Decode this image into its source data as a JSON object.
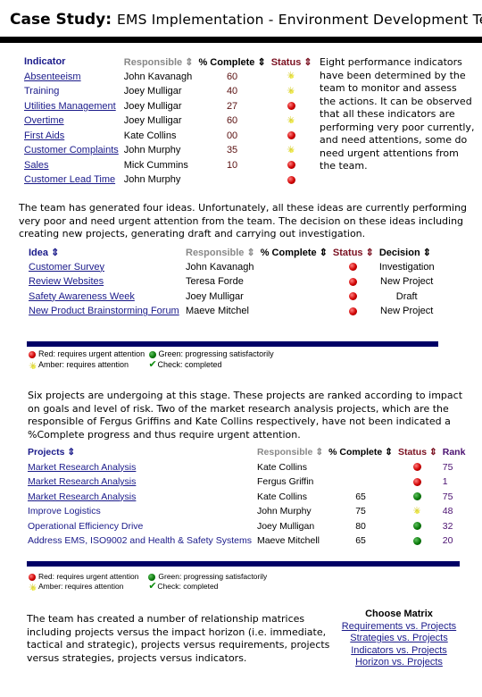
{
  "header": {
    "label": "Case Study:",
    "title": "EMS Implementation - Environment Development Team"
  },
  "indicators": {
    "columns": [
      "Indicator",
      "Responsible ⇕",
      "% Complete ⇕",
      "Status ⇕"
    ],
    "rows": [
      {
        "name": "Absenteeism",
        "link": true,
        "responsible": "John Kavanagh",
        "complete": "60",
        "status": "amber"
      },
      {
        "name": "Training",
        "link": false,
        "responsible": "Joey Mulligar",
        "complete": "40",
        "status": "amber"
      },
      {
        "name": "Utilities Management",
        "link": true,
        "responsible": "Joey Mulligar",
        "complete": "27",
        "status": "red"
      },
      {
        "name": "Overtime",
        "link": true,
        "responsible": "Joey Mulligar",
        "complete": "60",
        "status": "amber"
      },
      {
        "name": "First Aids",
        "link": true,
        "responsible": "Kate Collins",
        "complete": "00",
        "status": "red"
      },
      {
        "name": "Customer Complaints",
        "link": true,
        "responsible": "John Murphy",
        "complete": "35",
        "status": "amber"
      },
      {
        "name": "Sales",
        "link": true,
        "responsible": "Mick Cummins",
        "complete": "10",
        "status": "red"
      },
      {
        "name": "Customer Lead Time",
        "link": true,
        "responsible": "John Murphy",
        "complete": "",
        "status": "red"
      }
    ],
    "note": "Eight performance indicators have been determined by the team to monitor and assess the actions. It can be observed that all these indicators are performing very poor currently, and need attentions, some do need urgent attentions from the team."
  },
  "ideas": {
    "intro": "The team has generated four ideas. Unfortunately, all these ideas are currently performing very poor and need urgent attention from the team. The decision on these ideas including creating new projects, generating draft and carrying out investigation.",
    "columns": [
      "Idea ⇕",
      "Responsible ⇕",
      "% Complete ⇕",
      "Status ⇕",
      "Decision ⇕"
    ],
    "rows": [
      {
        "name": "Customer Survey",
        "responsible": "John Kavanagh",
        "complete": "",
        "status": "red",
        "decision": "Investigation"
      },
      {
        "name": "Review Websites",
        "responsible": "Teresa Forde",
        "complete": "",
        "status": "red",
        "decision": "New Project"
      },
      {
        "name": "Safety Awareness Week",
        "responsible": "Joey Mulligar",
        "complete": "",
        "status": "red",
        "decision": "Draft"
      },
      {
        "name": "New Product Brainstorming Forum",
        "responsible": "Maeve Mitchel",
        "complete": "",
        "status": "red",
        "decision": "New Project"
      }
    ]
  },
  "legend": {
    "red": "Red: requires urgent attention",
    "green": "Green: progressing satisfactorily",
    "amber": "Amber: requires attention",
    "check": "Check: completed"
  },
  "projects": {
    "intro": "Six projects are undergoing at this stage. These projects are ranked according to impact on goals and level of risk. Two of the market research analysis projects, which are the responsible of Fergus Griffins and Kate Collins respectively, have not been indicated a %Complete progress and thus require urgent attention.",
    "columns": [
      "Projects ⇕",
      "Responsible ⇕",
      "% Complete ⇕",
      "Status ⇕",
      "Rank"
    ],
    "rows": [
      {
        "name": "Market Research Analysis",
        "link": true,
        "responsible": "Kate Collins",
        "complete": "",
        "status": "red",
        "rank": "75"
      },
      {
        "name": "Market Research Analysis",
        "link": true,
        "responsible": "Fergus Griffin",
        "complete": "",
        "status": "red",
        "rank": "1"
      },
      {
        "name": "Market Research Analysis",
        "link": true,
        "responsible": "Kate Collins",
        "complete": "65",
        "status": "green",
        "rank": "75"
      },
      {
        "name": "Improve Logistics",
        "link": false,
        "responsible": "John Murphy",
        "complete": "75",
        "status": "amber",
        "rank": "48"
      },
      {
        "name": "Operational Efficiency Drive",
        "link": false,
        "responsible": "Joey Mulligan",
        "complete": "80",
        "status": "green",
        "rank": "32"
      },
      {
        "name": "Address EMS, ISO9002 and Health & Safety Systems",
        "link": false,
        "responsible": "Maeve Mitchell",
        "complete": "65",
        "status": "green",
        "rank": "20"
      }
    ]
  },
  "matrices": {
    "intro": "The team has created a number of relationship matrices including projects versus the impact horizon (i.e. immediate, tactical and strategic), projects versus requirements, projects versus strategies, projects versus indicators.",
    "heading": "Choose Matrix",
    "links": [
      "Requirements vs. Projects",
      "Strategies vs. Projects",
      "Indicators vs. Projects",
      "Horizon vs. Projects"
    ]
  },
  "colors": {
    "link": "#1a1a8a",
    "divider": "#000066",
    "status_red": "#d00000",
    "status_green": "#0a7a0a",
    "status_amber": "#f4f060"
  }
}
